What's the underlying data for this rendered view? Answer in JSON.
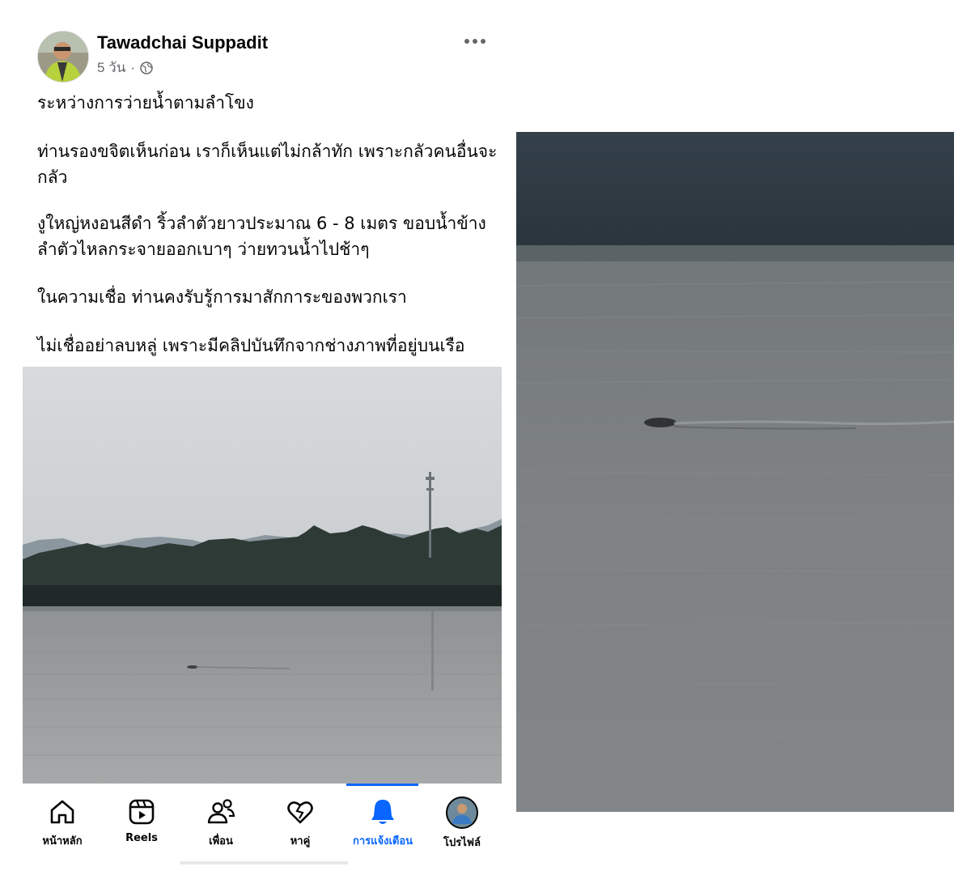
{
  "post": {
    "author_name": "Tawadchai Suppadit",
    "time": "5 วัน",
    "separator": "·",
    "paragraphs": [
      "ระหว่างการว่ายน้ำตามลำโขง",
      "ท่านรองขจิตเห็นก่อน เราก็เห็นแต่ไม่กล้าทัก เพราะกลัวคนอื่นจะกลัว",
      "งูใหญ่หงอนสีดำ ริ้วลำตัวยาวประมาณ 6 - 8 เมตร ขอบน้ำข้างลำตัวไหลกระจายออกเบาๆ ว่ายทวนน้ำไปช้าๆ",
      "ในความเชื่อ ท่านคงรับรู้การมาสักการะของพวกเรา",
      "ไม่เชื่ออย่าลบหลู่ เพราะมีคลิปบันทึกจากช่างภาพที่อยู่บนเรือ"
    ]
  },
  "nav": {
    "items": [
      {
        "label": "หน้าหลัก",
        "icon": "home-icon"
      },
      {
        "label": "Reels",
        "icon": "reels-icon"
      },
      {
        "label": "เพื่อน",
        "icon": "friends-icon"
      },
      {
        "label": "หาคู่",
        "icon": "dating-heart-icon"
      },
      {
        "label": "การแจ้งเตือน",
        "icon": "bell-icon",
        "active": true
      },
      {
        "label": "โปรไฟล์",
        "icon": "profile-avatar-icon"
      }
    ]
  },
  "colors": {
    "accent": "#0866ff",
    "text": "#050505",
    "secondary": "#65676b"
  }
}
